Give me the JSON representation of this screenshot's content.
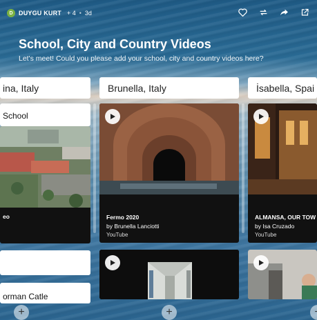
{
  "topbar": {
    "avatar_letter": "D",
    "author": "DUYGU KURT",
    "likes": "+ 4",
    "age": "3d",
    "icons": [
      "heart-icon",
      "remix-icon",
      "share-icon",
      "open-external-icon"
    ]
  },
  "header": {
    "title": "School, City and Country Videos",
    "subtitle": "Let's meet! Could you please add your school, city and country videos here?"
  },
  "columns": [
    {
      "title": "ina, Italy"
    },
    {
      "title": "Brunella, Italy"
    },
    {
      "title": "İsabella, Spai"
    }
  ],
  "cards": {
    "col1_school": "School",
    "col1_video_title": "eo",
    "col1_bottom_text": "orman Catle",
    "fermo": {
      "title": "Fermo 2020",
      "by": "by Brunella Lanciotti",
      "source": "YouTube"
    },
    "almansa": {
      "title": "ALMANSA, OUR TOW",
      "by": "by Isa Cruzado",
      "source": "YouTube"
    }
  },
  "add_button_label": "+"
}
